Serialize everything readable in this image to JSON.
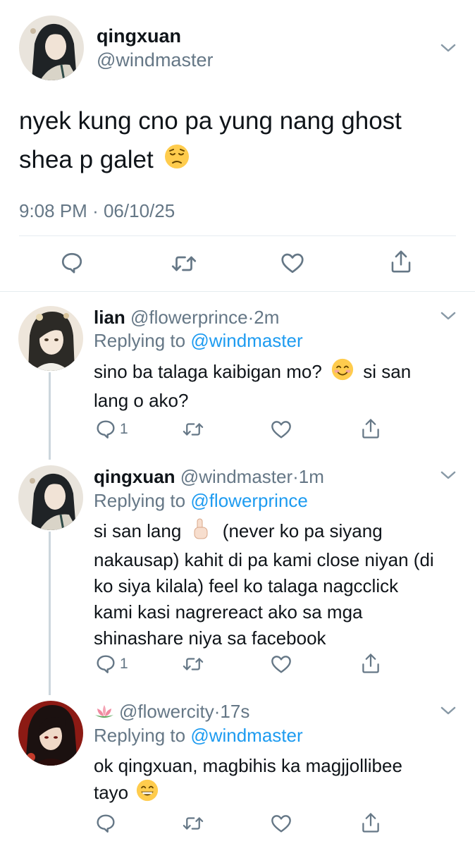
{
  "main_tweet": {
    "display_name": "qingxuan",
    "handle": "@windmaster",
    "text_line1": "nyek kung cno pa yung nang ghost",
    "text_line2": "shea p galet",
    "time": "9:08 PM",
    "sep": "·",
    "date": "06/10/25"
  },
  "replies": [
    {
      "display_name": "lian",
      "handle": "@flowerprince",
      "sep": "·",
      "age": "2m",
      "replying_prefix": "Replying to",
      "replying_to": "@windmaster",
      "body_a": "sino ba talaga kaibigan mo?",
      "body_b": "si san",
      "body_c": "lang o ako?",
      "reply_count": "1"
    },
    {
      "display_name": "qingxuan",
      "handle": "@windmaster",
      "sep": "·",
      "age": "1m",
      "replying_prefix": "Replying to",
      "replying_to": "@flowerprince",
      "body_a": "si san lang",
      "body_b": "(never ko pa siyang",
      "body_c": "nakausap) kahit di pa kami close niyan (di",
      "body_d": "ko siya kilala) feel ko talaga nagcclick",
      "body_e": "kami kasi nagrereact ako sa mga",
      "body_f": "shinashare niya sa facebook",
      "reply_count": "1"
    },
    {
      "display_name": "",
      "handle": "@flowercity",
      "sep": "·",
      "age": "17s",
      "replying_prefix": "Replying to",
      "replying_to": "@windmaster",
      "body_a": "ok qingxuan, magbihis ka magjjollibee",
      "body_b": "tayo",
      "reply_count": ""
    }
  ],
  "icons": {
    "reply": "reply-icon",
    "retweet": "retweet-icon",
    "like": "heart-icon",
    "share": "share-icon",
    "menu": "chevron-down-icon"
  },
  "colors": {
    "link_blue": "#1d9bf0",
    "muted_gray": "#657786",
    "divider": "#e6ecf0"
  }
}
